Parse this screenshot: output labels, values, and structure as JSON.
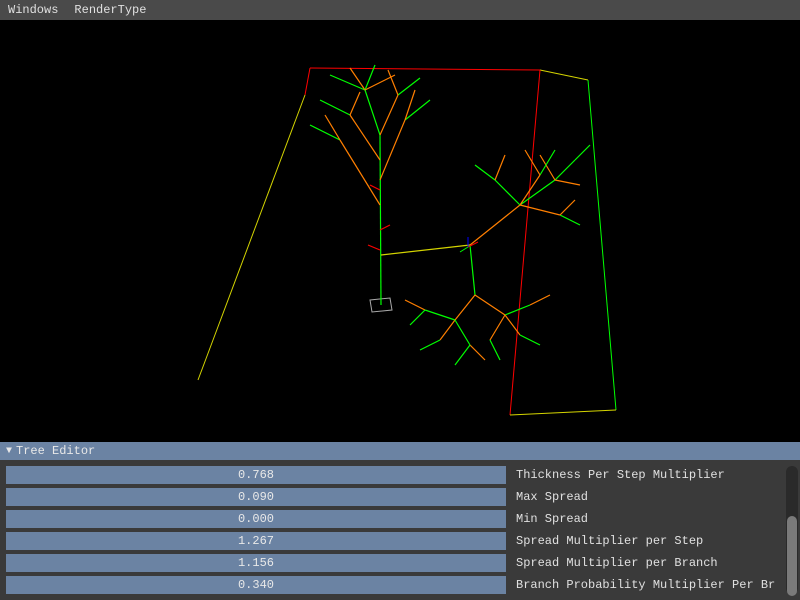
{
  "menubar": {
    "items": [
      "Windows",
      "RenderType"
    ]
  },
  "panel": {
    "title": "Tree Editor",
    "params": [
      {
        "value": "0.768",
        "label": "Thickness Per Step Multiplier"
      },
      {
        "value": "0.090",
        "label": "Max Spread"
      },
      {
        "value": "0.000",
        "label": "Min Spread"
      },
      {
        "value": "1.267",
        "label": "Spread Multiplier per Step"
      },
      {
        "value": "1.156",
        "label": "Spread Multiplier per Branch"
      },
      {
        "value": "0.340",
        "label": "Branch Probability Multiplier Per Br"
      }
    ]
  },
  "colors": {
    "menubar": "#4a4a4a",
    "panel_bg": "#3a3a3a",
    "panel_header": "#6b83a3",
    "slider_fill": "#6b83a3",
    "text": "#e0e0e0",
    "tree_green": "#00ff00",
    "tree_orange": "#ff7f00",
    "tree_red": "#ff0000",
    "tree_yellow": "#d4d400"
  }
}
